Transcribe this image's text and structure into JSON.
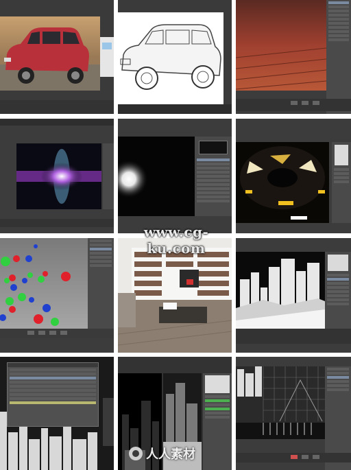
{
  "gallery": {
    "tiles": [
      {
        "id": "tile-1-mini-car-render"
      },
      {
        "id": "tile-2-mini-car-sketch"
      },
      {
        "id": "tile-3-wood-floor"
      },
      {
        "id": "tile-4-lens-flare"
      },
      {
        "id": "tile-5-glow-light"
      },
      {
        "id": "tile-6-light-rays"
      },
      {
        "id": "tile-7-colored-spheres"
      },
      {
        "id": "tile-8-living-room"
      },
      {
        "id": "tile-9-white-city"
      },
      {
        "id": "tile-10-city-attributes"
      },
      {
        "id": "tile-11-depth-city"
      },
      {
        "id": "tile-12-grid-city"
      }
    ]
  },
  "watermarks": {
    "site_text": "www.cg-ku.com",
    "logo_text": "人人素材"
  },
  "colors": {
    "app_background": "#3c3c3c",
    "panel": "#4a4a4a",
    "car_red": "#b8303a",
    "lens_purple": "#a040d0",
    "sphere_red": "#e0202a",
    "sphere_green": "#30d040",
    "sphere_blue": "#2040d0"
  }
}
